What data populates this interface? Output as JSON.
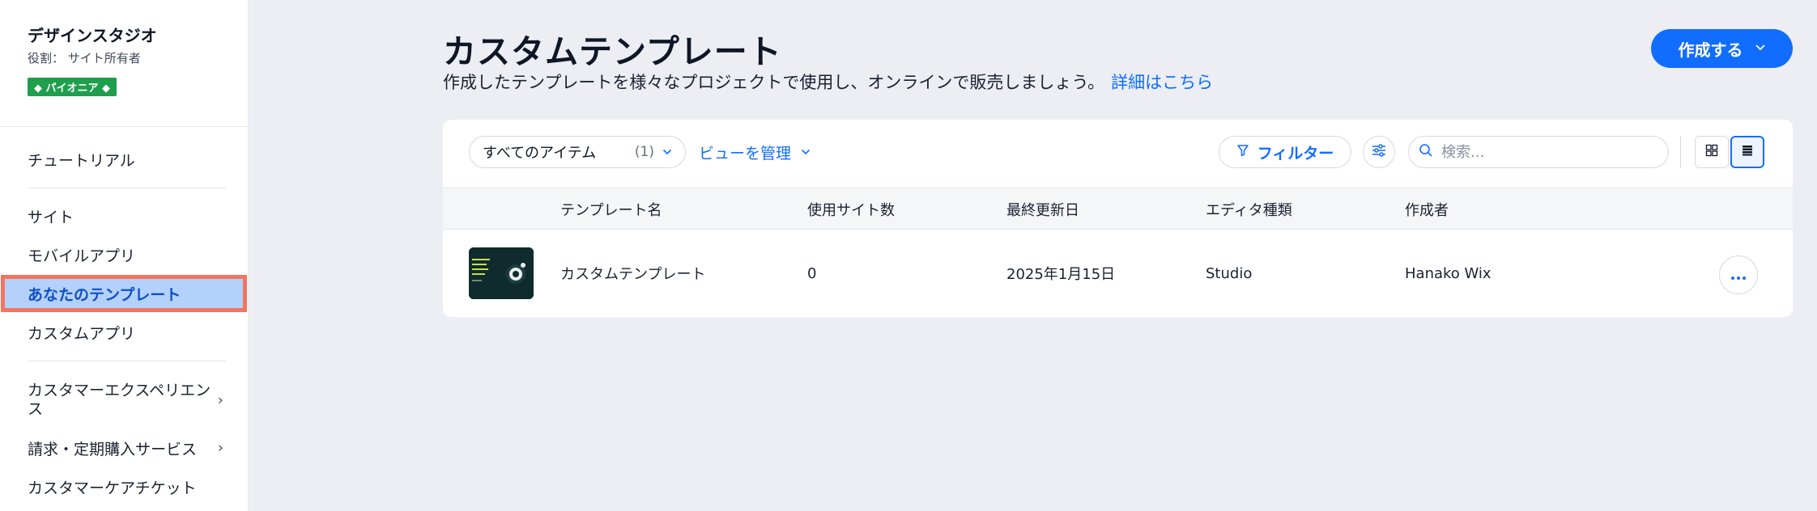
{
  "sidebar": {
    "account": {
      "name": "デザインスタジオ",
      "role": "役割： サイト所有者",
      "badge": "◆ パイオニア ◆"
    },
    "items": [
      {
        "label": "チュートリアル"
      },
      {
        "label": "サイト"
      },
      {
        "label": "モバイルアプリ"
      },
      {
        "label": "あなたのテンプレート",
        "active": true
      },
      {
        "label": "カスタムアプリ"
      },
      {
        "label": "カスタマーエクスペリエンス",
        "has_submenu": true
      },
      {
        "label": "請求・定期購入サービス",
        "has_submenu": true
      },
      {
        "label": "カスタマーケアチケット"
      }
    ]
  },
  "header": {
    "title": "カスタムテンプレート",
    "subtitle": "作成したテンプレートを様々なプロジェクトで使用し、オンラインで販売しましょう。",
    "learn_more": "詳細はこちら",
    "create_button": "作成する"
  },
  "toolbar": {
    "view_select": {
      "label": "すべてのアイテム",
      "count": "(1)"
    },
    "manage_views": "ビューを管理",
    "filter": "フィルター",
    "search_placeholder": "検索..."
  },
  "table": {
    "columns": [
      "テンプレート名",
      "使用サイト数",
      "最終更新日",
      "エディタ種類",
      "作成者"
    ],
    "rows": [
      {
        "name": "カスタムテンプレート",
        "sites": "0",
        "updated": "2025年1月15日",
        "editor": "Studio",
        "author": "Hanako Wix"
      }
    ]
  },
  "colors": {
    "accent": "#116dff",
    "active_bg": "#b3d1fa",
    "highlight_border": "#f4745e",
    "badge": "#1f9e4d"
  }
}
